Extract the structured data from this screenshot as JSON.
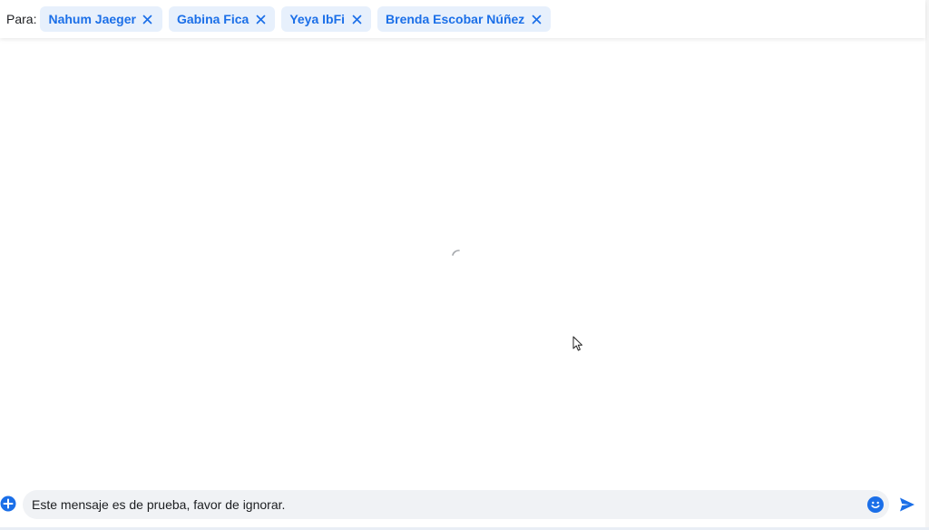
{
  "header": {
    "to_label": "Para:",
    "recipients": [
      {
        "name": "Nahum Jaeger"
      },
      {
        "name": "Gabina Fica"
      },
      {
        "name": "Yeya IbFi"
      },
      {
        "name": "Brenda Escobar Núñez"
      }
    ],
    "remove_icon": "close-icon"
  },
  "main": {
    "state": "loading",
    "spinner_icon": "loading-spinner-icon"
  },
  "composer": {
    "message_value": "Este mensaje es de prueba, favor de ignorar.",
    "add_icon": "plus-circle-icon",
    "emoji_icon": "smiley-icon",
    "send_icon": "send-icon"
  },
  "colors": {
    "accent": "#1b6fe8",
    "chip_bg": "#e7f0fc",
    "composer_bg": "#f0f2f5",
    "text": "#1c1e21"
  }
}
